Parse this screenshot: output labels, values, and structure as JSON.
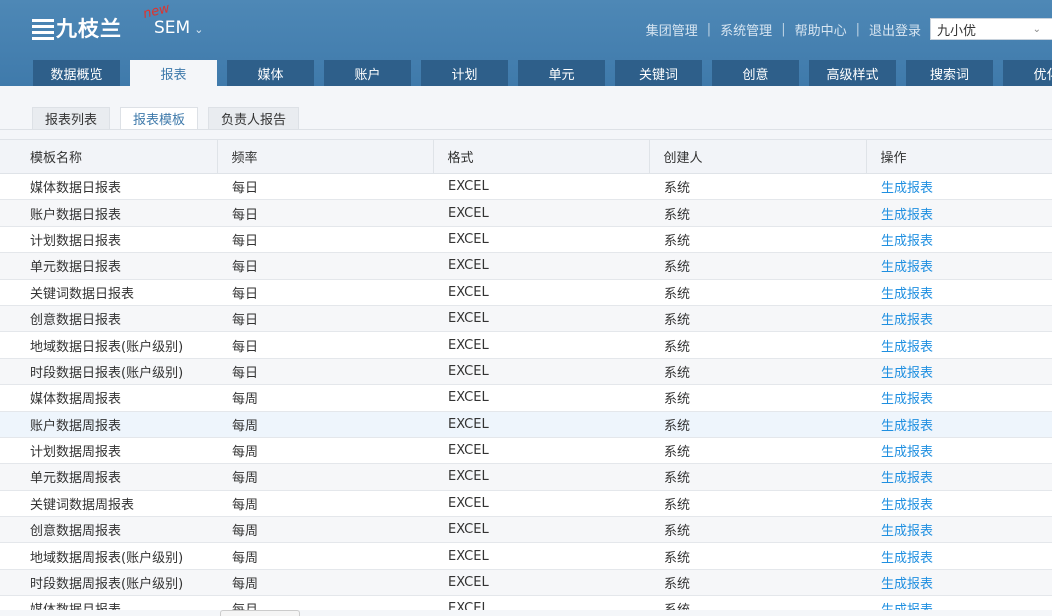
{
  "header": {
    "logo_text": "九枝兰",
    "new_tag": "new",
    "product": "SEM",
    "links": [
      "集团管理",
      "系统管理",
      "帮助中心",
      "退出登录"
    ],
    "user": "九小优"
  },
  "nav": [
    "数据概览",
    "报表",
    "媒体",
    "账户",
    "计划",
    "单元",
    "关键词",
    "创意",
    "高级样式",
    "搜索词",
    "优化"
  ],
  "subtabs": [
    "报表列表",
    "报表模板",
    "负责人报告"
  ],
  "table": {
    "headers": [
      "模板名称",
      "频率",
      "格式",
      "创建人",
      "操作"
    ],
    "rows": [
      [
        "媒体数据日报表",
        "每日",
        "EXCEL",
        "系统",
        "生成报表"
      ],
      [
        "账户数据日报表",
        "每日",
        "EXCEL",
        "系统",
        "生成报表"
      ],
      [
        "计划数据日报表",
        "每日",
        "EXCEL",
        "系统",
        "生成报表"
      ],
      [
        "单元数据日报表",
        "每日",
        "EXCEL",
        "系统",
        "生成报表"
      ],
      [
        "关键词数据日报表",
        "每日",
        "EXCEL",
        "系统",
        "生成报表"
      ],
      [
        "创意数据日报表",
        "每日",
        "EXCEL",
        "系统",
        "生成报表"
      ],
      [
        "地域数据日报表(账户级别)",
        "每日",
        "EXCEL",
        "系统",
        "生成报表"
      ],
      [
        "时段数据日报表(账户级别)",
        "每日",
        "EXCEL",
        "系统",
        "生成报表"
      ],
      [
        "媒体数据周报表",
        "每周",
        "EXCEL",
        "系统",
        "生成报表"
      ],
      [
        "账户数据周报表",
        "每周",
        "EXCEL",
        "系统",
        "生成报表"
      ],
      [
        "计划数据周报表",
        "每周",
        "EXCEL",
        "系统",
        "生成报表"
      ],
      [
        "单元数据周报表",
        "每周",
        "EXCEL",
        "系统",
        "生成报表"
      ],
      [
        "关键词数据周报表",
        "每周",
        "EXCEL",
        "系统",
        "生成报表"
      ],
      [
        "创意数据周报表",
        "每周",
        "EXCEL",
        "系统",
        "生成报表"
      ],
      [
        "地域数据周报表(账户级别)",
        "每周",
        "EXCEL",
        "系统",
        "生成报表"
      ],
      [
        "时段数据周报表(账户级别)",
        "每周",
        "EXCEL",
        "系统",
        "生成报表"
      ],
      [
        "媒体数据月报表",
        "每月",
        "EXCEL",
        "系统",
        "生成报表"
      ]
    ]
  }
}
